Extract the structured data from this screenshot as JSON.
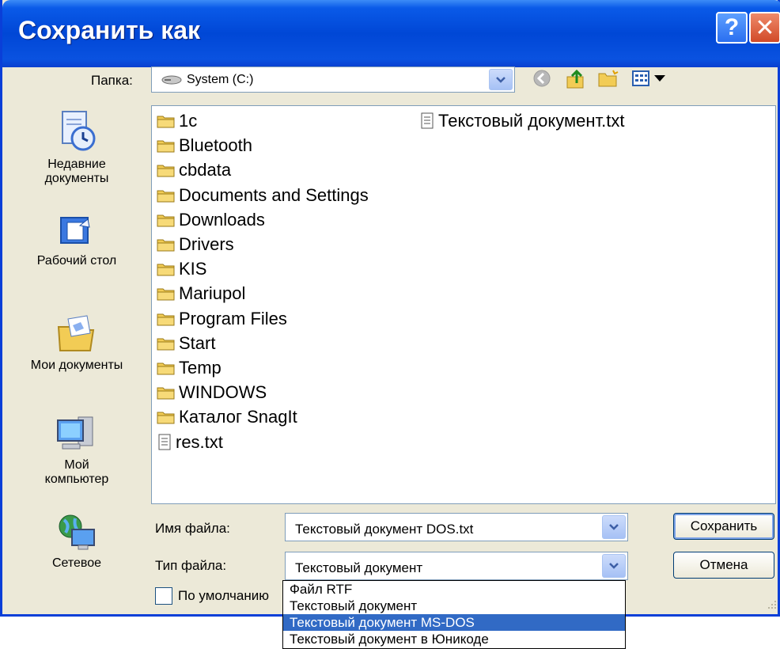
{
  "window": {
    "title": "Сохранить как",
    "help_glyph": "?",
    "close_glyph": "✕"
  },
  "lookin": {
    "label": "Папка:",
    "value": "System (C:)"
  },
  "places": [
    {
      "label_line1": "Недавние",
      "label_line2": "документы",
      "icon": "recent-documents-icon"
    },
    {
      "label_line1": "Рабочий стол",
      "label_line2": "",
      "icon": "desktop-icon"
    },
    {
      "label_line1": "Мои документы",
      "label_line2": "",
      "icon": "my-documents-icon"
    },
    {
      "label_line1": "Мой",
      "label_line2": "компьютер",
      "icon": "my-computer-icon"
    },
    {
      "label_line1": "Сетевое",
      "label_line2": "",
      "icon": "network-icon"
    }
  ],
  "files": [
    {
      "name": "1c",
      "type": "folder"
    },
    {
      "name": "Bluetooth",
      "type": "folder"
    },
    {
      "name": "cbdata",
      "type": "folder"
    },
    {
      "name": "Documents and Settings",
      "type": "folder"
    },
    {
      "name": "Downloads",
      "type": "folder"
    },
    {
      "name": "Drivers",
      "type": "folder"
    },
    {
      "name": "KIS",
      "type": "folder"
    },
    {
      "name": "Mariupol",
      "type": "folder"
    },
    {
      "name": "Program Files",
      "type": "folder"
    },
    {
      "name": "Start",
      "type": "folder"
    },
    {
      "name": "Temp",
      "type": "folder"
    },
    {
      "name": "WINDOWS",
      "type": "folder"
    },
    {
      "name": "Каталог SnagIt",
      "type": "folder"
    },
    {
      "name": "res.txt",
      "type": "text"
    },
    {
      "name": "Текстовый документ.txt",
      "type": "text"
    }
  ],
  "filename": {
    "label": "Имя файла:",
    "value": "Текстовый документ DOS.txt"
  },
  "filetype": {
    "label": "Тип файла:",
    "value": "Текстовый документ"
  },
  "buttons": {
    "save": "Сохранить",
    "cancel": "Отмена"
  },
  "default_checkbox": {
    "label": "По умолчанию"
  },
  "filetype_options": [
    {
      "label": "Файл RTF",
      "selected": false
    },
    {
      "label": "Текстовый документ",
      "selected": false
    },
    {
      "label": "Текстовый документ MS-DOS",
      "selected": true
    },
    {
      "label": "Текстовый документ в Юникоде",
      "selected": false
    }
  ],
  "colors": {
    "titlebar": "#0047d6",
    "dialog_bg": "#ece9d8",
    "selection": "#316ac5",
    "folder": "#f2cc55"
  }
}
